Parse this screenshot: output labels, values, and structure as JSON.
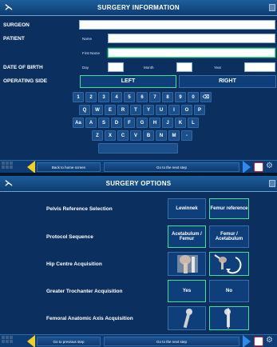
{
  "surgery_info": {
    "title": "SURGERY INFORMATION",
    "fields": {
      "surgeon": "SURGEON",
      "patient": "PATIENT",
      "name": "Name",
      "first_name": "First Name",
      "dob": "DATE OF BIRTH",
      "day": "Day",
      "month": "Month",
      "year": "Year",
      "operating_side": "OPERATING SIDE",
      "left": "LEFT",
      "right": "RIGHT"
    },
    "keyboard": {
      "row1": [
        "1",
        "2",
        "3",
        "4",
        "5",
        "6",
        "7",
        "8",
        "9",
        "0",
        "⌫"
      ],
      "row2": [
        "Q",
        "W",
        "E",
        "R",
        "T",
        "Y",
        "U",
        "I",
        "O",
        "P"
      ],
      "row3": [
        "Aa",
        "A",
        "S",
        "D",
        "F",
        "G",
        "H",
        "J",
        "K",
        "L"
      ],
      "row4": [
        "Z",
        "X",
        "C",
        "V",
        "B",
        "N",
        "M",
        "-"
      ]
    },
    "nav": {
      "back": "Back to home screen",
      "next": "Go to the next step"
    }
  },
  "surgery_options": {
    "title": "SURGERY OPTIONS",
    "rows": [
      {
        "label": "Pelvis Reference Selection",
        "a": "Lewinnek",
        "b": "Femur reference",
        "selected": "b"
      },
      {
        "label": "Protocol Sequence",
        "a": "Acetabulum / Femur",
        "b": "Femur / Acetabulum",
        "selected": "a"
      },
      {
        "label": "Hip Centre Acquisition",
        "a": "",
        "b": "",
        "selected": "b"
      },
      {
        "label": "Greater Trochanter Acquisition",
        "a": "Yes",
        "b": "No",
        "selected": "a"
      },
      {
        "label": "Femoral Anatomic Axis Acquisition",
        "a": "",
        "b": "",
        "selected": "b"
      }
    ],
    "nav": {
      "back": "Go to previous step",
      "next": "Go to the next step"
    }
  },
  "colors": {
    "accent_green": "#46e08e",
    "arrow_yellow": "#f2d020",
    "arrow_blue": "#2f8af0"
  }
}
